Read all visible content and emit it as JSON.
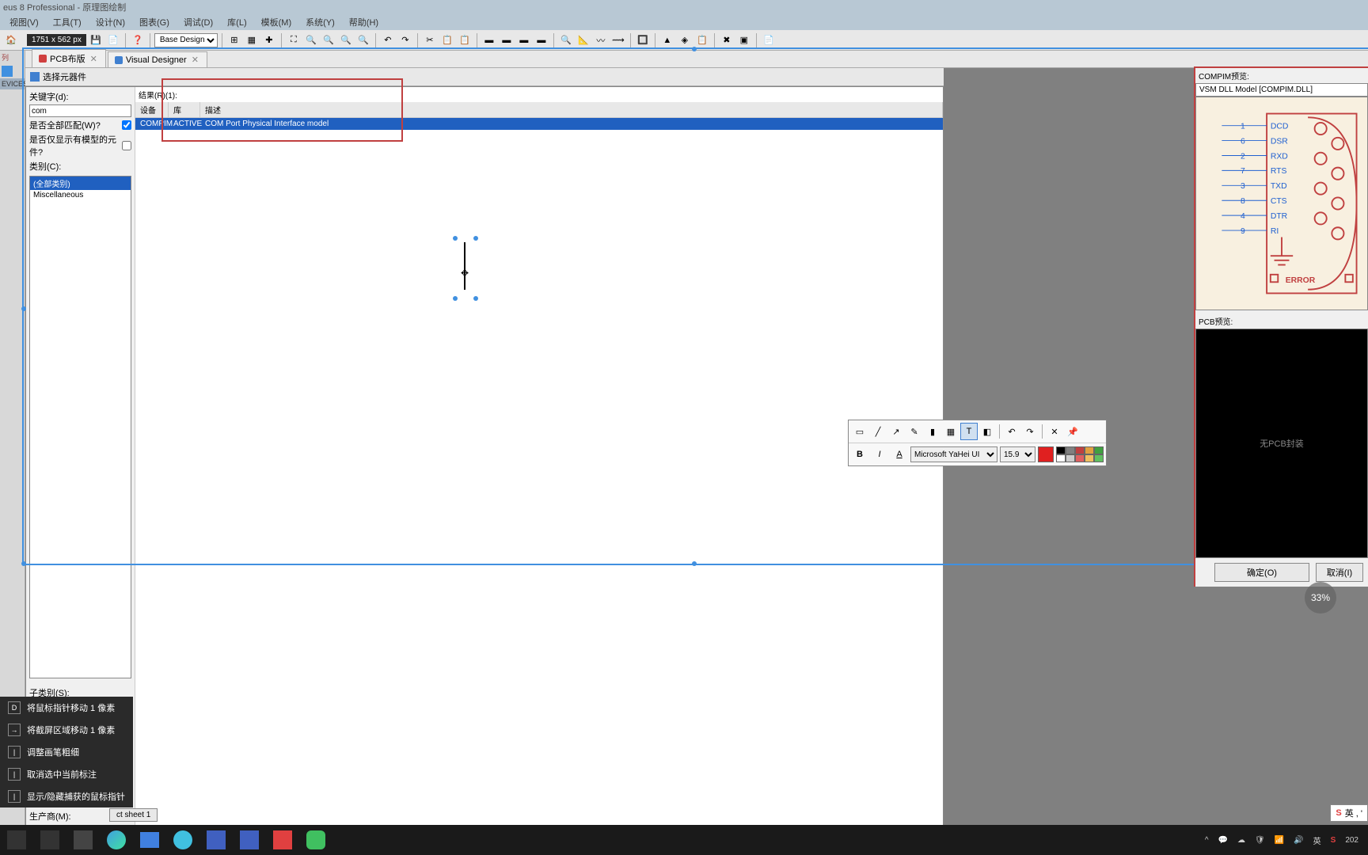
{
  "title": "eus 8 Professional - 原理图绘制",
  "menu": [
    "视图(V)",
    "工具(T)",
    "设计(N)",
    "图表(G)",
    "调试(D)",
    "库(L)",
    "模板(M)",
    "系统(Y)",
    "帮助(H)"
  ],
  "dim_badge": "1751 x 562 px",
  "design_combo": "Base Design",
  "tabs": [
    {
      "label": "PCB布版",
      "active": false
    },
    {
      "label": "Visual Designer",
      "active": false
    }
  ],
  "picker": {
    "title": "选择元器件",
    "keyword_label": "关键字(d):",
    "keyword_value": "com",
    "match_all_label": "是否全部匹配(W)?",
    "show_models_label": "是否仅显示有模型的元件?",
    "category_label": "类别(C):",
    "categories": [
      {
        "label": "(全部类别)",
        "selected": true
      },
      {
        "label": "Miscellaneous",
        "selected": false
      }
    ],
    "subcategory_label": "子类别(S):",
    "manufacturer_label": "生产商(M):",
    "results_label": "结果(R)(1):",
    "columns": {
      "device": "设备",
      "lib": "库",
      "desc": "描述"
    },
    "results": [
      {
        "device": "COMPIM",
        "lib": "ACTIVE",
        "desc": "COM Port Physical Interface model",
        "selected": true
      }
    ]
  },
  "preview": {
    "header": "COMPIM预览:",
    "subtitle": "VSM DLL Model [COMPIM.DLL]",
    "pins": [
      {
        "num": "1",
        "name": "DCD"
      },
      {
        "num": "6",
        "name": "DSR"
      },
      {
        "num": "2",
        "name": "RXD"
      },
      {
        "num": "7",
        "name": "RTS"
      },
      {
        "num": "3",
        "name": "TXD"
      },
      {
        "num": "8",
        "name": "CTS"
      },
      {
        "num": "4",
        "name": "DTR"
      },
      {
        "num": "9",
        "name": "RI"
      }
    ],
    "error": "ERROR",
    "pcb_header": "PCB预览:",
    "pcb_text": "无PCB封装"
  },
  "editor": {
    "font": "Microsoft YaHei UI",
    "size": "15.9"
  },
  "buttons": {
    "ok": "确定(O)",
    "cancel": "取消(I)"
  },
  "hints": [
    {
      "key": "D",
      "text": "将鼠标指针移动 1 像素"
    },
    {
      "key": "→",
      "text": "将截屏区域移动 1 像素"
    },
    {
      "key": "|",
      "text": "调整画笔粗细"
    },
    {
      "key": "|",
      "text": "取消选中当前标注"
    },
    {
      "key": "|",
      "text": "显示/隐藏捕获的鼠标指针"
    }
  ],
  "footer_tab": "ct sheet 1",
  "progress": "33%",
  "ime": "英",
  "tray": {
    "ime1": "英",
    "ime2": "英 , '"
  }
}
